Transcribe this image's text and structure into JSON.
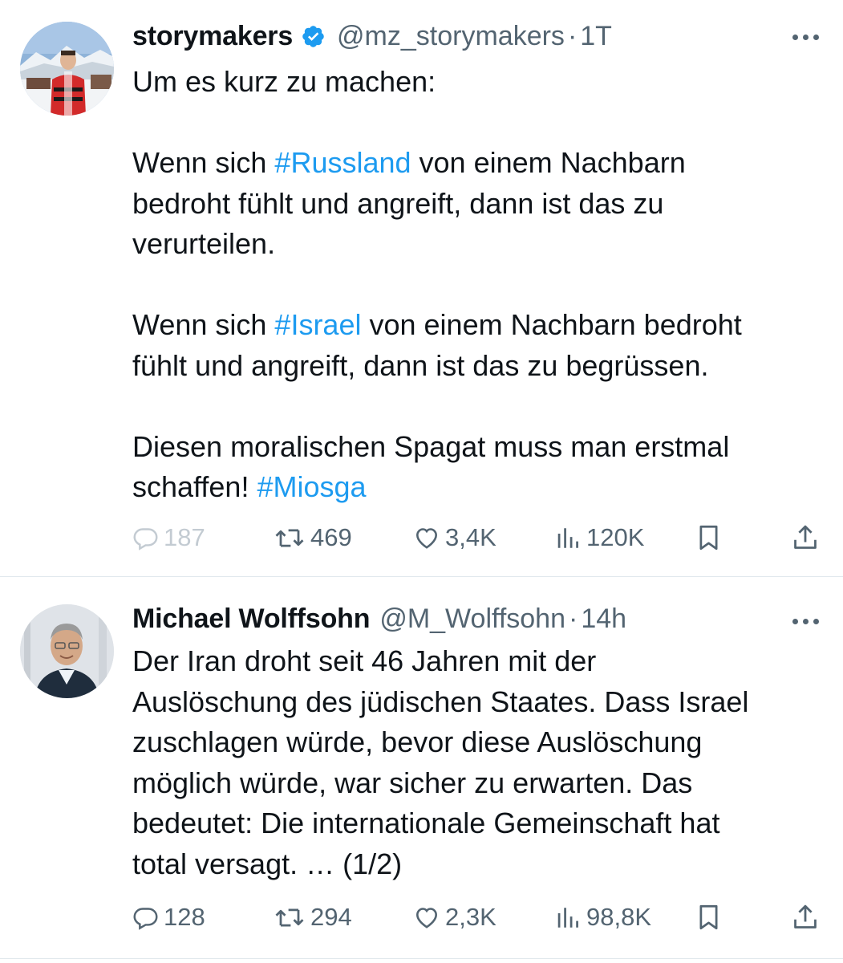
{
  "tweets": [
    {
      "name": "storymakers",
      "verified": true,
      "handle": "@mz_storymakers",
      "separator": "·",
      "time": "1T",
      "lines": [
        [
          {
            "t": "Um es kurz zu machen:"
          }
        ],
        [],
        [
          {
            "t": "Wenn sich "
          },
          {
            "t": "#Russland",
            "h": true
          },
          {
            "t": " von einem Nachbarn"
          }
        ],
        [
          {
            "t": "bedroht fühlt und angreift, dann ist das zu"
          }
        ],
        [
          {
            "t": "verurteilen."
          }
        ],
        [],
        [
          {
            "t": "Wenn sich "
          },
          {
            "t": "#Israel",
            "h": true
          },
          {
            "t": " von einem Nachbarn bedroht"
          }
        ],
        [
          {
            "t": "fühlt und angreift, dann ist das zu begrüssen."
          }
        ],
        [],
        [
          {
            "t": "Diesen moralischen Spagat muss man erstmal"
          }
        ],
        [
          {
            "t": "schaffen! "
          },
          {
            "t": "#Miosga",
            "h": true
          }
        ]
      ],
      "replies": "187",
      "retweets": "469",
      "likes": "3,4K",
      "views": "120K"
    },
    {
      "name": "Michael Wolffsohn",
      "verified": false,
      "handle": "@M_Wolffsohn",
      "separator": "·",
      "time": "14h",
      "lines": [
        [
          {
            "t": "Der Iran droht seit 46 Jahren mit der"
          }
        ],
        [
          {
            "t": "Auslöschung des jüdischen Staates. Dass Israel"
          }
        ],
        [
          {
            "t": "zuschlagen würde, bevor diese Auslöschung"
          }
        ],
        [
          {
            "t": "möglich würde, war sicher zu erwarten. Das"
          }
        ],
        [
          {
            "t": "bedeutet: Die internationale Gemeinschaft hat"
          }
        ],
        [
          {
            "t": "total versagt. … (1/2)"
          }
        ]
      ],
      "replies": "128",
      "retweets": "294",
      "likes": "2,3K",
      "views": "98,8K"
    }
  ],
  "icons": {
    "reply": "reply-icon",
    "retweet": "retweet-icon",
    "like": "heart-icon",
    "views": "views-icon",
    "bookmark": "bookmark-icon",
    "share": "share-icon",
    "more": "more-icon",
    "verified": "verified-badge-icon"
  },
  "colors": {
    "hashtag": "#1d9bf0",
    "verified": "#1d9bf0",
    "secondary_text": "#536471",
    "primary_text": "#0f1419"
  }
}
